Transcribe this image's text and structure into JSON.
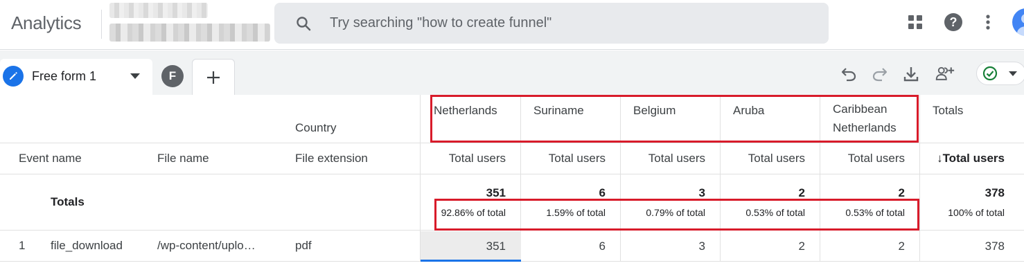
{
  "app": {
    "title": "Analytics"
  },
  "search": {
    "placeholder": "Try searching \"how to create funnel\""
  },
  "top_icons": [
    "apps-grid-icon",
    "help-icon",
    "more-vert-icon",
    "account-avatar"
  ],
  "tabs": {
    "active_label": "Free form 1",
    "secondary_badge": "F"
  },
  "toolbar_icons": [
    "undo-icon",
    "redo-icon",
    "download-icon",
    "share-users-icon",
    "status-check-icon"
  ],
  "table": {
    "dimension_header_top": "Country",
    "dimension_headers": [
      "Event name",
      "File name",
      "File extension"
    ],
    "countries": [
      "Netherlands",
      "Suriname",
      "Belgium",
      "Aruba",
      "Caribbean",
      "Netherlands"
    ],
    "totals_header": "Totals",
    "metric_label": "Total users",
    "sorted_metric_label": "↓Total users",
    "totals_row": {
      "label": "Totals",
      "values": [
        "351",
        "6",
        "3",
        "2",
        "2",
        "378"
      ],
      "percents": [
        "92.86% of total",
        "1.59% of total",
        "0.79% of total",
        "0.53% of total",
        "0.53% of total",
        "100% of total"
      ]
    },
    "rows": [
      {
        "index": "1",
        "event_name": "file_download",
        "file_name": "/wp-content/uplo…",
        "file_extension": "pdf",
        "values": [
          "351",
          "6",
          "3",
          "2",
          "2",
          "378"
        ]
      }
    ]
  },
  "colors": {
    "highlight_border": "#d81b2a",
    "accent": "#1a73e8"
  }
}
